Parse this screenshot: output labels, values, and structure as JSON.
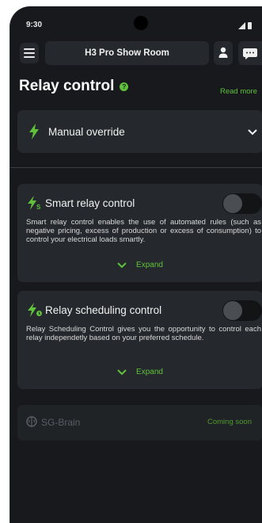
{
  "status_bar": {
    "time": "9:30"
  },
  "header": {
    "title": "H3 Pro Show Room"
  },
  "page": {
    "title": "Relay control",
    "read_more": "Read more"
  },
  "manual": {
    "label": "Manual override"
  },
  "smart": {
    "title": "Smart relay control",
    "description": "Smart relay control enables the use of automated rules (such as negative pricing, excess of production or excess of consumption) to control your electrical loads smartly.",
    "expand": "Expand",
    "enabled": false
  },
  "scheduling": {
    "title": "Relay scheduling control",
    "description": "Relay Scheduling Control gives you the opportunity to control each relay independetly based on your preferred schedule.",
    "expand": "Expand",
    "enabled": false
  },
  "sg_brain": {
    "title": "SG-Brain",
    "status": "Coming soon"
  },
  "colors": {
    "accent": "#5fc23a",
    "background": "#17191c",
    "card": "#25282c"
  },
  "icons": [
    "menu-icon",
    "user-icon",
    "chat-icon",
    "help-icon",
    "lightning-icon",
    "smart-lightning-icon",
    "schedule-lightning-icon",
    "chevron-down-icon",
    "brain-icon"
  ]
}
